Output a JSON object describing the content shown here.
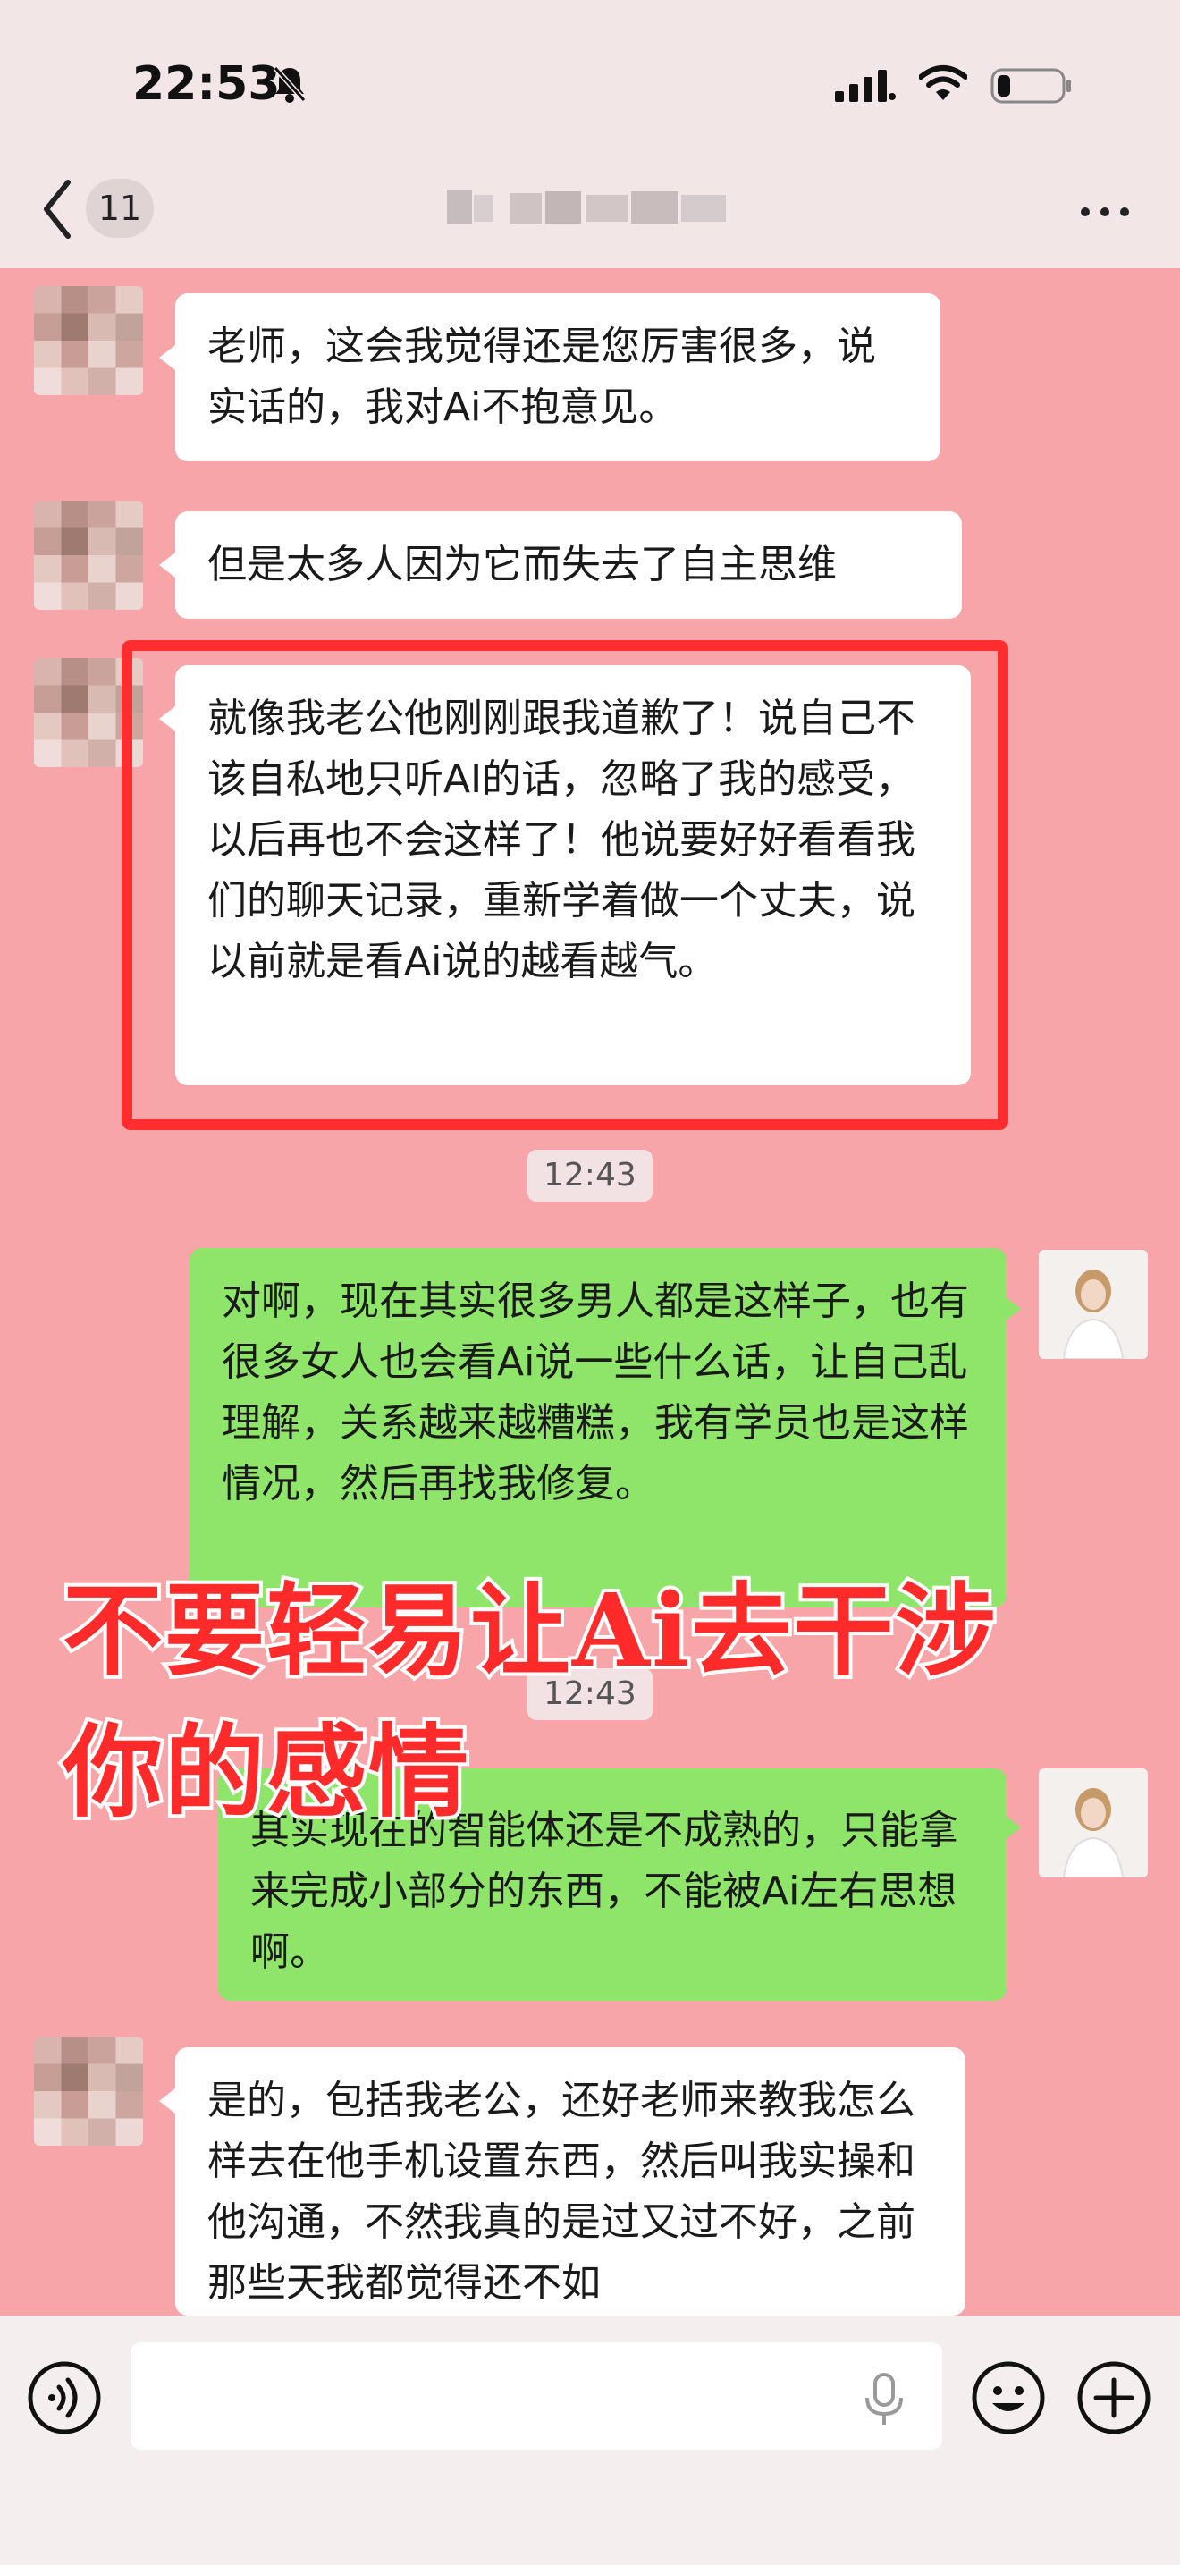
{
  "status_bar": {
    "time": "22:53"
  },
  "header": {
    "back_count": "11",
    "title": ""
  },
  "messages": [
    {
      "side": "left",
      "text": "老师，这会我觉得还是您厉害很多，说实话的，我对Ai不抱意见。"
    },
    {
      "side": "left",
      "text": "但是太多人因为它而失去了自主思维"
    },
    {
      "side": "left",
      "text": "就像我老公他刚刚跟我道歉了！说自己不该自私地只听AI的话，忽略了我的感受，以后再也不会这样了！他说要好好看看我们的聊天记录，重新学着做一个丈夫，说以前就是看Ai说的越看越气。"
    },
    {
      "side": "time",
      "text": "12:43"
    },
    {
      "side": "right",
      "text": "对啊，现在其实很多男人都是这样子，也有很多女人也会看Ai说一些什么话，让自己乱理解，关系越来越糟糕，我有学员也是这样情况，然后再找我修复。"
    },
    {
      "side": "time",
      "text": "12:43"
    },
    {
      "side": "right",
      "text": "其实现在的智能体还是不成熟的，只能拿来完成小部分的东西，不能被Ai左右思想啊。"
    },
    {
      "side": "left",
      "text": "是的，包括我老公，还好老师来教我怎么样去在他手机设置东西，然后叫我实操和他沟通，不然我真的是过又过不好，之前那些天我都觉得还不如"
    }
  ],
  "overlay_caption": {
    "line1": "不要轻易让Ai去干涉",
    "line2": "你的感情"
  },
  "colors": {
    "chat_bg": "#f7a5a8",
    "sent_bubble": "#8ee56a",
    "received_bubble": "#ffffff",
    "highlight_border": "#ff2d2d",
    "caption": "#ff2a2a"
  },
  "icons": [
    "bell-slash-icon",
    "cellular-signal-icon",
    "wifi-icon",
    "battery-icon",
    "back-chevron-icon",
    "more-icon",
    "voice-icon",
    "microphone-icon",
    "emoji-icon",
    "plus-icon"
  ]
}
